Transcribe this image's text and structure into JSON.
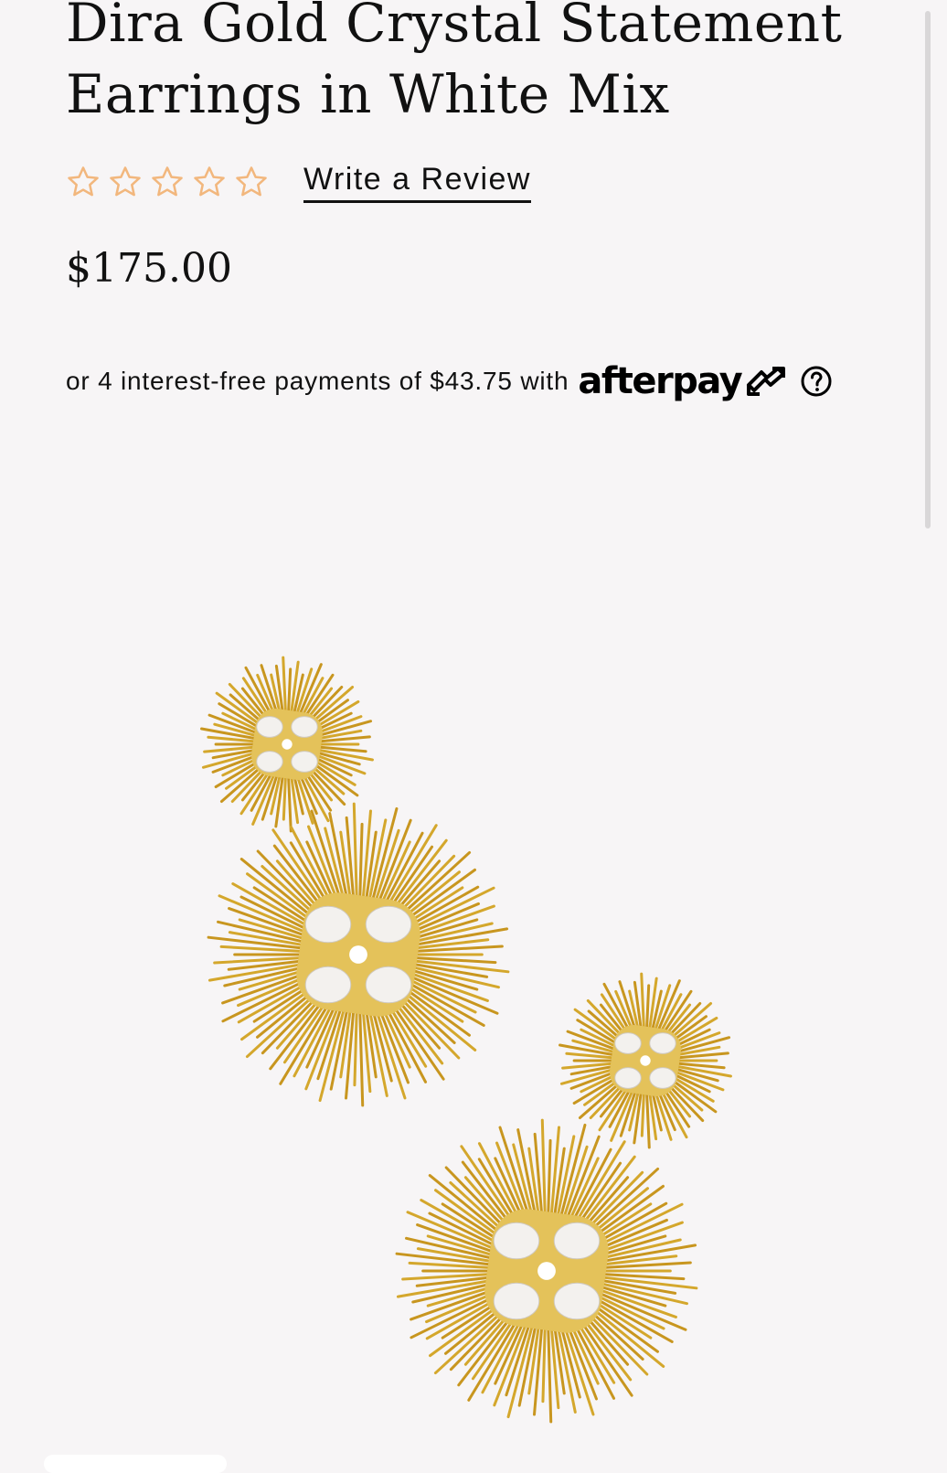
{
  "product": {
    "title": "Dira Gold Crystal Statement Earrings in White Mix",
    "price": "$175.00",
    "image_alt": "Dira Gold Crystal Statement Earrings in White Mix"
  },
  "rating": {
    "value": 0,
    "max": 5,
    "star_color": "#f2b77d",
    "review_link": "Write a Review"
  },
  "afterpay": {
    "text": "or 4 interest-free payments of $43.75 with",
    "brand": "afterpay",
    "logo_icon": "afterpay-arrows-icon",
    "info_icon": "question-circle-icon"
  },
  "colors": {
    "background": "#f7f5f6",
    "text": "#111111",
    "gold": "#d4a72c"
  }
}
